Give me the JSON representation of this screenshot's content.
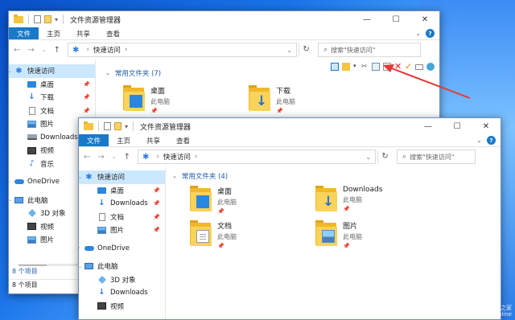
{
  "back_window": {
    "title": "文件资源管理器",
    "ribbon_tabs": [
      "文件",
      "主页",
      "共享",
      "查看"
    ],
    "address": "快速访问",
    "search_placeholder": "搜索\"快速访问\"",
    "nav_items": [
      {
        "label": "快速访问",
        "icon": "star-icon"
      },
      {
        "label": "桌面",
        "icon": "desktop-icon"
      },
      {
        "label": "下载",
        "icon": "download-icon"
      },
      {
        "label": "文档",
        "icon": "document-icon"
      },
      {
        "label": "图片",
        "icon": "pictures-icon"
      },
      {
        "label": "Downloads (V",
        "icon": "drive-icon"
      },
      {
        "label": "视频",
        "icon": "video-icon"
      },
      {
        "label": "音乐",
        "icon": "music-icon"
      },
      {
        "label": "OneDrive",
        "icon": "cloud-icon"
      },
      {
        "label": "此电脑",
        "icon": "pc-icon"
      },
      {
        "label": "3D 对象",
        "icon": "3d-icon"
      },
      {
        "label": "视频",
        "icon": "video-icon"
      },
      {
        "label": "图片",
        "icon": "pictures-icon"
      }
    ],
    "group_header": "常用文件夹 (7)",
    "folders": [
      {
        "name": "桌面",
        "location": "此电脑"
      },
      {
        "name": "下载",
        "location": "此电脑"
      }
    ],
    "status_top": "8 个项目",
    "status_bottom": "8 个项目"
  },
  "front_window": {
    "title": "文件资源管理器",
    "ribbon_tabs": [
      "文件",
      "主页",
      "共享",
      "查看"
    ],
    "address": "快速访问",
    "search_placeholder": "搜索\"快速访问\"",
    "nav_items": [
      {
        "label": "快速访问",
        "icon": "star-icon"
      },
      {
        "label": "桌面",
        "icon": "desktop-icon"
      },
      {
        "label": "Downloads",
        "icon": "download-icon"
      },
      {
        "label": "文档",
        "icon": "document-icon"
      },
      {
        "label": "图片",
        "icon": "pictures-icon"
      },
      {
        "label": "OneDrive",
        "icon": "cloud-icon"
      },
      {
        "label": "此电脑",
        "icon": "pc-icon"
      },
      {
        "label": "3D 对象",
        "icon": "3d-icon"
      },
      {
        "label": "Downloads",
        "icon": "download-icon"
      },
      {
        "label": "视频",
        "icon": "video-icon"
      }
    ],
    "group_header": "常用文件夹 (4)",
    "folders": [
      {
        "name": "桌面",
        "location": "此电脑"
      },
      {
        "name": "Downloads",
        "location": "此电脑"
      },
      {
        "name": "文档",
        "location": "此电脑"
      },
      {
        "name": "图片",
        "location": "此电脑"
      }
    ]
  },
  "watermark": {
    "line1": "IT之家",
    "line2": "online"
  },
  "colors": {
    "accent": "#1979ca",
    "selection": "#cce8ff",
    "arrow": "#e53935"
  }
}
